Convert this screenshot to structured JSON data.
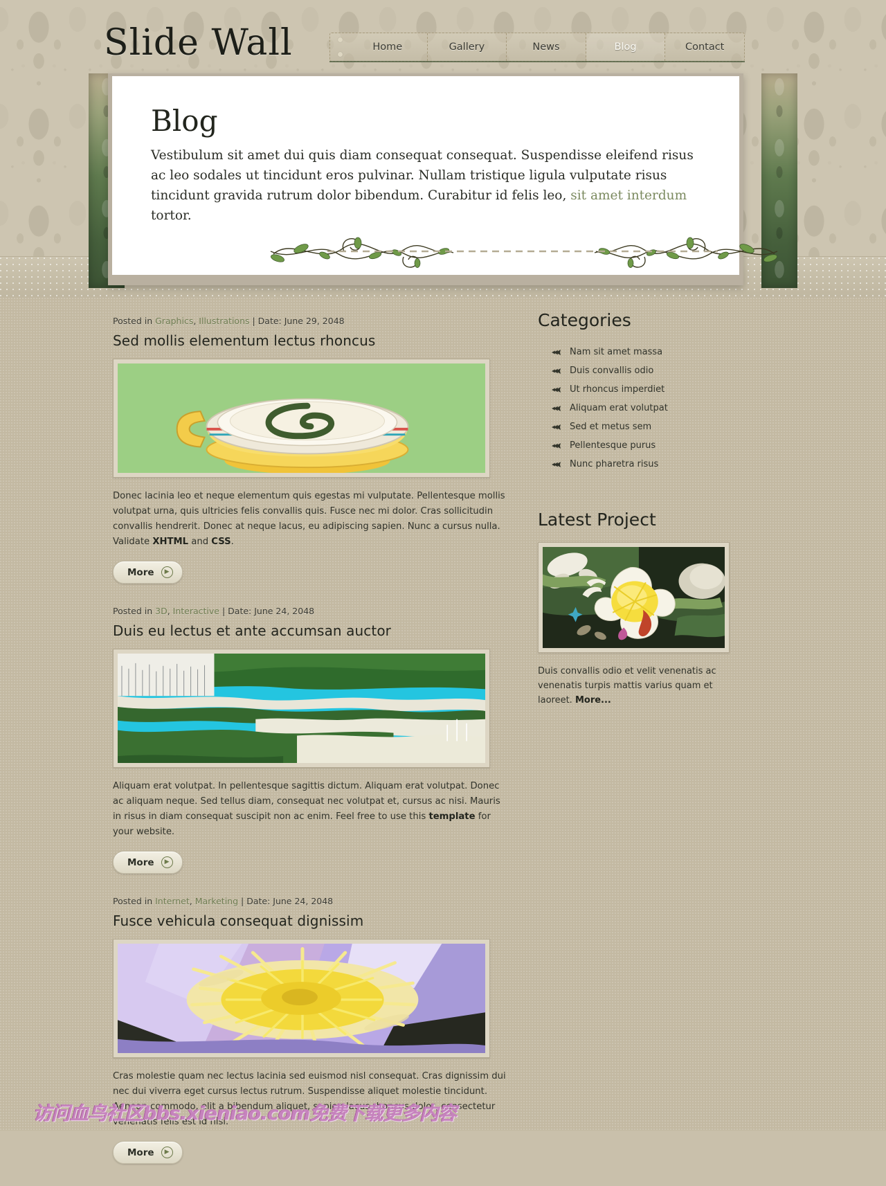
{
  "site": {
    "logo": "Slide Wall"
  },
  "nav": {
    "items": [
      {
        "label": "Home",
        "active": false
      },
      {
        "label": "Gallery",
        "active": false
      },
      {
        "label": "News",
        "active": false
      },
      {
        "label": "Blog",
        "active": true
      },
      {
        "label": "Contact",
        "active": false
      }
    ]
  },
  "hero": {
    "title": "Blog",
    "intro_part1": "Vestibulum sit amet dui quis diam consequat consequat. Suspendisse eleifend risus ac leo sodales ut tincidunt eros pulvinar. Nullam tristique ligula vulputate risus tincidunt gravida rutrum dolor bibendum. Curabitur id felis leo, ",
    "intro_link": "sit amet interdum",
    "intro_part2": " tortor.",
    "ornament_icon": "floral-vine-divider"
  },
  "posts": [
    {
      "posted_in_label": "Posted in ",
      "categories": [
        "Graphics",
        "Illustrations"
      ],
      "date_label": " | Date: ",
      "date": "June 29, 2048",
      "title": "Sed mollis elementum lectus rhoncus",
      "image_alt": "coffee-cup-illustration",
      "body_part1": "Donec lacinia leo et neque elementum quis egestas mi vulputate. Pellentesque mollis volutpat urna, quis ultricies felis convallis quis. Fusce nec mi dolor. Cras sollicitudin convallis hendrerit. Donec at neque lacus, eu adipiscing sapien. Nunc a cursus nulla. Validate ",
      "body_bold1": "XHTML",
      "body_mid": " and ",
      "body_bold2": "CSS",
      "body_end": ".",
      "more_label": "More"
    },
    {
      "posted_in_label": "Posted in ",
      "categories": [
        "3D",
        "Interactive"
      ],
      "date_label": " | Date: ",
      "date": "June 24, 2048",
      "title": "Duis eu lectus et ante accumsan auctor",
      "image_alt": "coastal-marina-photo",
      "body_part1": "Aliquam erat volutpat. In pellentesque sagittis dictum. Aliquam erat volutpat. Donec ac aliquam neque. Sed tellus diam, consequat nec volutpat et, cursus ac nisi. Mauris in risus in diam consequat suscipit non ac enim. Feel free to use this ",
      "body_bold1": "template",
      "body_mid": " for your website.",
      "body_bold2": "",
      "body_end": "",
      "more_label": "More"
    },
    {
      "posted_in_label": "Posted in ",
      "categories": [
        "Internet",
        "Marketing"
      ],
      "date_label": " | Date: ",
      "date": "June 24, 2048",
      "title": "Fusce vehicula consequat dignissim",
      "image_alt": "yellow-flower-abstract",
      "body_part1": "Cras molestie quam nec lectus lacinia sed euismod nisl consequat. Cras dignissim dui nec dui viverra eget cursus lectus rutrum. Suspendisse aliquet molestie tincidunt. Aenean commodo, elit a bibendum aliquet, sapien lacus rhoncus dolor, consectetur venenatis felis est id nisi.",
      "body_bold1": "",
      "body_mid": "",
      "body_bold2": "",
      "body_end": "",
      "more_label": "More"
    }
  ],
  "sidebar": {
    "categories_title": "Categories",
    "categories": [
      "Nam sit amet massa",
      "Duis convallis odio",
      "Ut rhoncus imperdiet",
      "Aliquam erat volutpat",
      "Sed et metus sem",
      "Pellentesque purus",
      "Nunc pharetra risus"
    ],
    "bullet_icon": "arrow-left-fleur-icon",
    "latest_project_title": "Latest Project",
    "latest_project_image_alt": "white-flower-photo",
    "latest_project_text": "Duis convallis odio et velit venenatis ac venenatis turpis mattis varius quam et laoreet. ",
    "latest_project_more": "More..."
  },
  "watermark": {
    "text": "访问血鸟社区bbs.xieniao.com免费下载更多内容"
  },
  "colors": {
    "page_bg": "#c3b9a2",
    "wallpaper": "#cdc5b1",
    "panel": "#ffffff",
    "link_green": "#707e53",
    "hero_link_green": "#7b8a5f",
    "curtain_green": "#46603c",
    "text_dark": "#23251e",
    "watermark_pink": "#c77fc0"
  }
}
